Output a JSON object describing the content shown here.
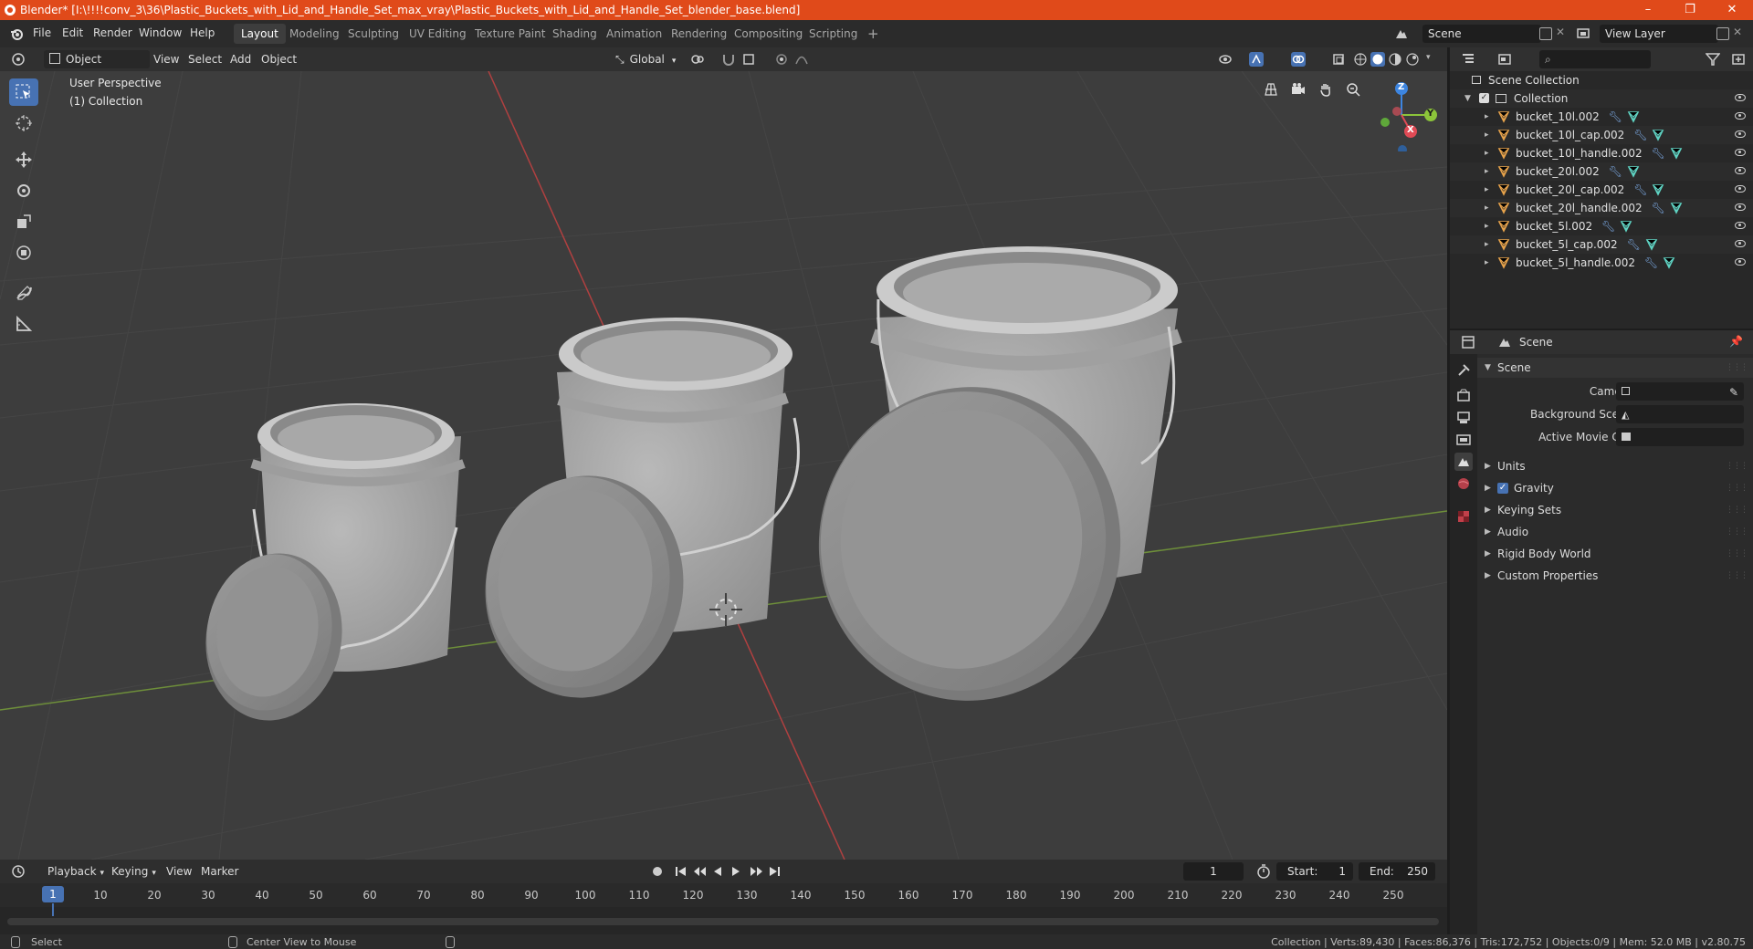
{
  "window": {
    "title": "Blender* [I:\\!!!!conv_3\\36\\Plastic_Buckets_with_Lid_and_Handle_Set_max_vray\\Plastic_Buckets_with_Lid_and_Handle_Set_blender_base.blend]",
    "minimize": "–",
    "restore": "❐",
    "close": "✕"
  },
  "menu": {
    "file": "File",
    "edit": "Edit",
    "render": "Render",
    "window": "Window",
    "help": "Help"
  },
  "workspaces": [
    "Layout",
    "Modeling",
    "Sculpting",
    "UV Editing",
    "Texture Paint",
    "Shading",
    "Animation",
    "Rendering",
    "Compositing",
    "Scripting"
  ],
  "workspace_add": "+",
  "scene_field": "Scene",
  "view_layer_field": "View Layer",
  "viewport_header": {
    "mode": "Object Mode",
    "view": "View",
    "select": "Select",
    "add": "Add",
    "object": "Object",
    "orientation": "Global"
  },
  "viewport": {
    "perspective_label": "User Perspective",
    "collection_label": "(1) Collection",
    "gizmo": {
      "z": "Z",
      "y": "Y",
      "x": "X"
    }
  },
  "outliner": {
    "search_placeholder": "",
    "scene_collection": "Scene Collection",
    "collection": "Collection",
    "items": [
      "bucket_10l.002",
      "bucket_10l_cap.002",
      "bucket_10l_handle.002",
      "bucket_20l.002",
      "bucket_20l_cap.002",
      "bucket_20l_handle.002",
      "bucket_5l.002",
      "bucket_5l_cap.002",
      "bucket_5l_handle.002"
    ]
  },
  "properties": {
    "header_title": "Scene",
    "section_title": "Scene",
    "camera_label": "Camera",
    "background_scene_label": "Background Scene",
    "active_movie_clip_label": "Active Movie Clip",
    "panels": [
      "Units",
      "Gravity",
      "Keying Sets",
      "Audio",
      "Rigid Body World",
      "Custom Properties"
    ],
    "gravity_checked": true
  },
  "timeline": {
    "playback": "Playback",
    "keying": "Keying",
    "view": "View",
    "marker": "Marker",
    "current_frame": "1",
    "start_label": "Start:",
    "start": "1",
    "end_label": "End:",
    "end": "250",
    "ticks": [
      "10",
      "20",
      "30",
      "40",
      "50",
      "60",
      "70",
      "80",
      "90",
      "100",
      "110",
      "120",
      "130",
      "140",
      "150",
      "160",
      "170",
      "180",
      "190",
      "200",
      "210",
      "220",
      "230",
      "240",
      "250"
    ],
    "cursor_frame": "1"
  },
  "statusbar": {
    "select": "Select",
    "center_view": "Center View to Mouse",
    "stats": "Collection | Verts:89,430 | Faces:86,376 | Tris:172,752 | Objects:0/9 | Mem: 52.0 MB | v2.80.75"
  },
  "colors": {
    "titlebar": "#e04a1a",
    "accent_blue": "#4772b3",
    "mesh_icon": "#e8a34b",
    "modifier_icon": "#7aa7e0",
    "data_icon": "#5fd3c3",
    "axis_x": "#e04a55",
    "axis_y": "#8cc43a",
    "axis_z": "#3d85e0"
  }
}
